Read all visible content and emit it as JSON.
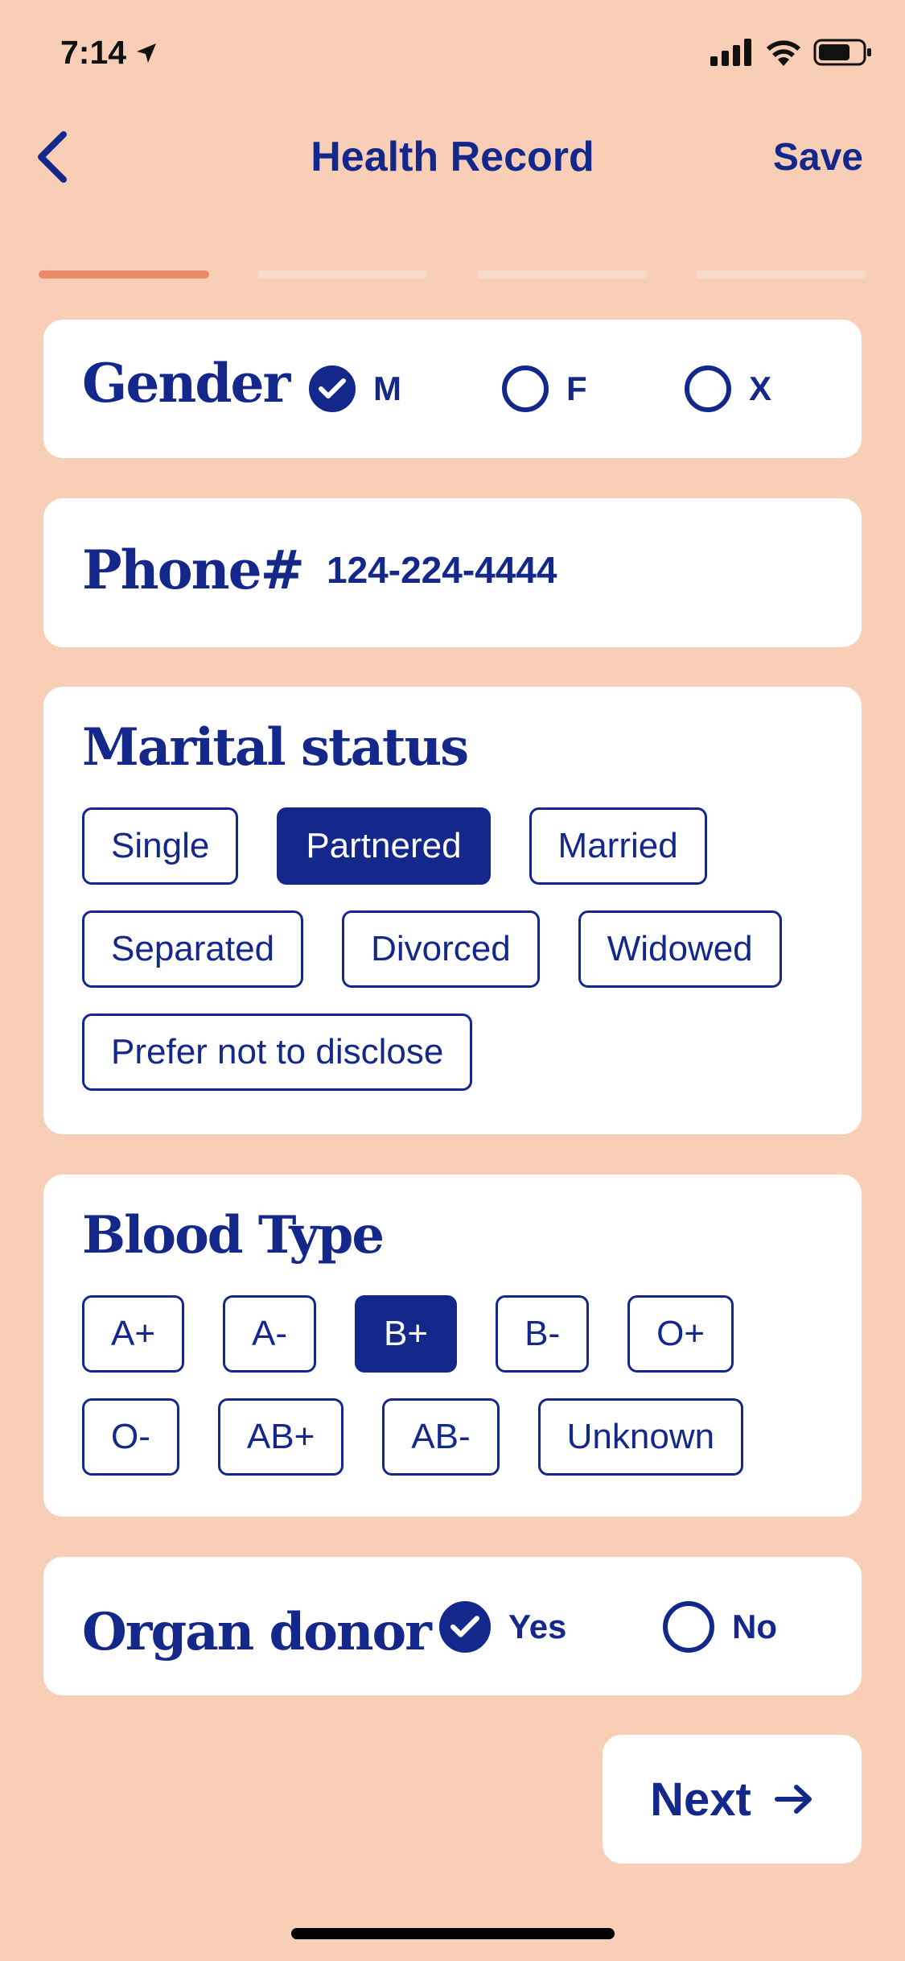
{
  "status_bar": {
    "time": "7:14"
  },
  "nav": {
    "title": "Health Record",
    "save_label": "Save"
  },
  "progress": {
    "total_steps": 4,
    "current_step": 1
  },
  "gender": {
    "title": "Gender",
    "options": [
      {
        "label": "M",
        "checked": true
      },
      {
        "label": "F",
        "checked": false
      },
      {
        "label": "X",
        "checked": false
      }
    ]
  },
  "phone": {
    "title": "Phone#",
    "value": "124-224-4444"
  },
  "marital": {
    "title": "Marital status",
    "options": [
      "Single",
      "Partnered",
      "Married",
      "Separated",
      "Divorced",
      "Widowed",
      "Prefer not to disclose"
    ],
    "selected": "Partnered"
  },
  "blood": {
    "title": "Blood Type",
    "options": [
      "A+",
      "A-",
      "B+",
      "B-",
      "O+",
      "O-",
      "AB+",
      "AB-",
      "Unknown"
    ],
    "selected": "B+"
  },
  "organ_donor": {
    "title": "Organ donor",
    "options": [
      {
        "label": "Yes",
        "checked": true
      },
      {
        "label": "No",
        "checked": false
      }
    ]
  },
  "next_label": "Next",
  "colors": {
    "background": "#f8cfb6",
    "primary": "#14288c",
    "accent": "#ea8a66",
    "card": "#ffffff"
  }
}
